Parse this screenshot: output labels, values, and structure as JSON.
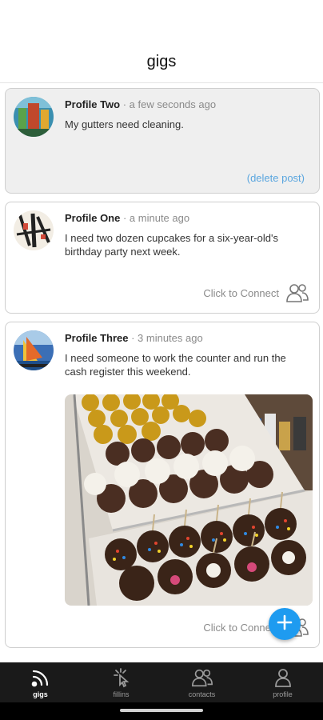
{
  "header": {
    "title": "gigs"
  },
  "posts": [
    {
      "author": "Profile Two",
      "time": "· a few seconds ago",
      "text": "My gutters need cleaning.",
      "action": "(delete post)"
    },
    {
      "author": "Profile One",
      "time": "· a minute ago",
      "text": "I need two dozen cupcakes for a six-year-old's birthday party next week.",
      "action": "Click to Connect"
    },
    {
      "author": "Profile Three",
      "time": "· 3 minutes ago",
      "text": "I need someone to work the counter and run the cash register this weekend.",
      "action": "Click to Connect"
    }
  ],
  "tabs": [
    {
      "label": "gigs",
      "icon": "feed-icon"
    },
    {
      "label": "fillins",
      "icon": "tap-icon"
    },
    {
      "label": "contacts",
      "icon": "people-icon"
    },
    {
      "label": "profile",
      "icon": "person-icon"
    }
  ],
  "colors": {
    "accent": "#1e9bf0",
    "link": "#5aa6df",
    "tabbar": "#1a1a1a"
  }
}
